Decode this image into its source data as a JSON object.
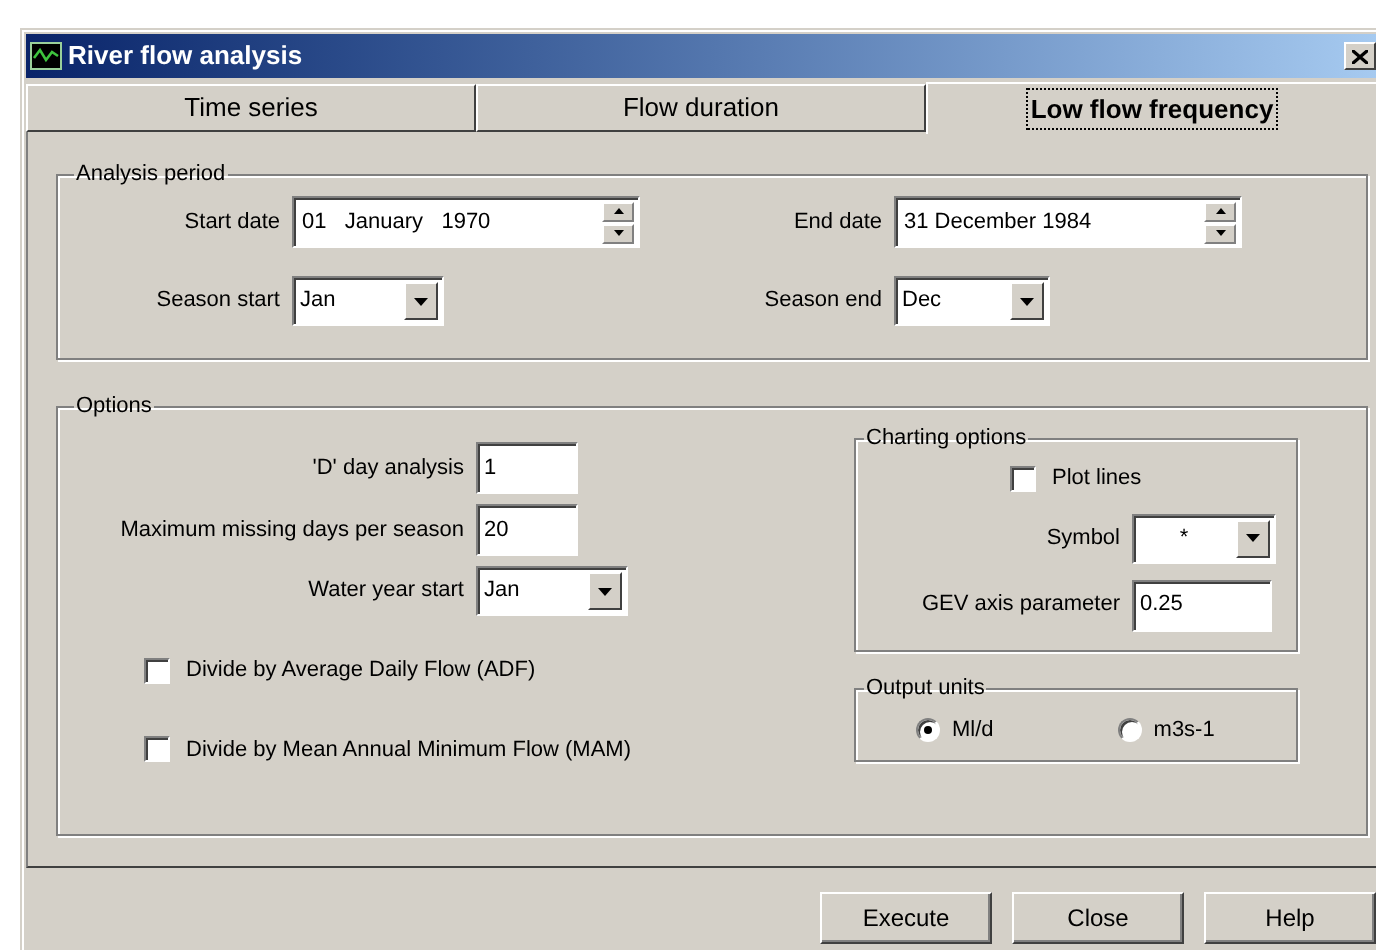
{
  "window": {
    "title": "River flow analysis"
  },
  "tabs": [
    {
      "label": "Time series",
      "selected": false
    },
    {
      "label": "Flow duration",
      "selected": false
    },
    {
      "label": "Low flow frequency",
      "selected": true
    }
  ],
  "analysis_period": {
    "title": "Analysis period",
    "start_date": {
      "label": "Start date",
      "value": "01   January   1970"
    },
    "end_date": {
      "label": "End date",
      "value": "31 December 1984"
    },
    "season_start": {
      "label": "Season start",
      "value": "Jan"
    },
    "season_end": {
      "label": "Season end",
      "value": "Dec"
    }
  },
  "options": {
    "title": "Options",
    "d_day": {
      "label": "'D' day analysis",
      "value": "1"
    },
    "max_missing": {
      "label": "Maximum missing days per season",
      "value": "20"
    },
    "water_year_start": {
      "label": "Water year start",
      "value": "Jan"
    },
    "checkboxes": [
      {
        "label": "Divide by Average Daily Flow (ADF)",
        "checked": false
      },
      {
        "label": "Divide by Mean Annual Minimum Flow (MAM)",
        "checked": false
      }
    ],
    "charting": {
      "title": "Charting options",
      "plot_lines": {
        "label": "Plot lines",
        "checked": false
      },
      "symbol": {
        "label": "Symbol",
        "value": "*"
      },
      "gev": {
        "label": "GEV axis parameter",
        "value": "0.25"
      }
    },
    "output_units": {
      "title": "Output units",
      "options": [
        {
          "label": "Ml/d",
          "selected": true
        },
        {
          "label": "m3s-1",
          "selected": false
        }
      ]
    }
  },
  "buttons": [
    "Execute",
    "Close",
    "Help"
  ]
}
